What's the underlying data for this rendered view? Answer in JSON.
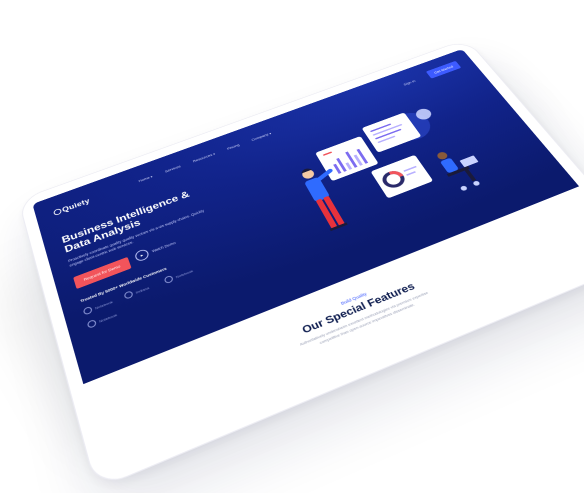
{
  "brand": {
    "name": "Quiety"
  },
  "nav": {
    "items": [
      "Home",
      "Services",
      "Resources",
      "Pricing",
      "Company"
    ],
    "sign_in": "Sign In",
    "get_started": "Get Started"
  },
  "hero": {
    "headline_line1": "Business Intelligence &",
    "headline_line2": "Data Analysis",
    "description": "Proactively coordinate quality quality vectors vis-a-vis supply chains. Quickly engage client-centric web services.",
    "cta": "Request for Demo",
    "watch": "Watch Demo",
    "trusted": "Trusted By 5000+ Worldwide Customers",
    "brands": [
      "Notebook",
      "Indiana",
      "Notebook",
      "Notebook"
    ]
  },
  "features": {
    "tag": "Build Quality",
    "title": "Our Special Features",
    "description_line1": "Authoritatively underwhelm excellent methodologies via premium expertise",
    "description_line2": "competitive than open-source imperatives disseminate."
  },
  "colors": {
    "hero_bg": "#11238a",
    "accent_blue": "#3d5bff",
    "cta_red": "#f2545b",
    "title_dark": "#0b1a4d"
  }
}
